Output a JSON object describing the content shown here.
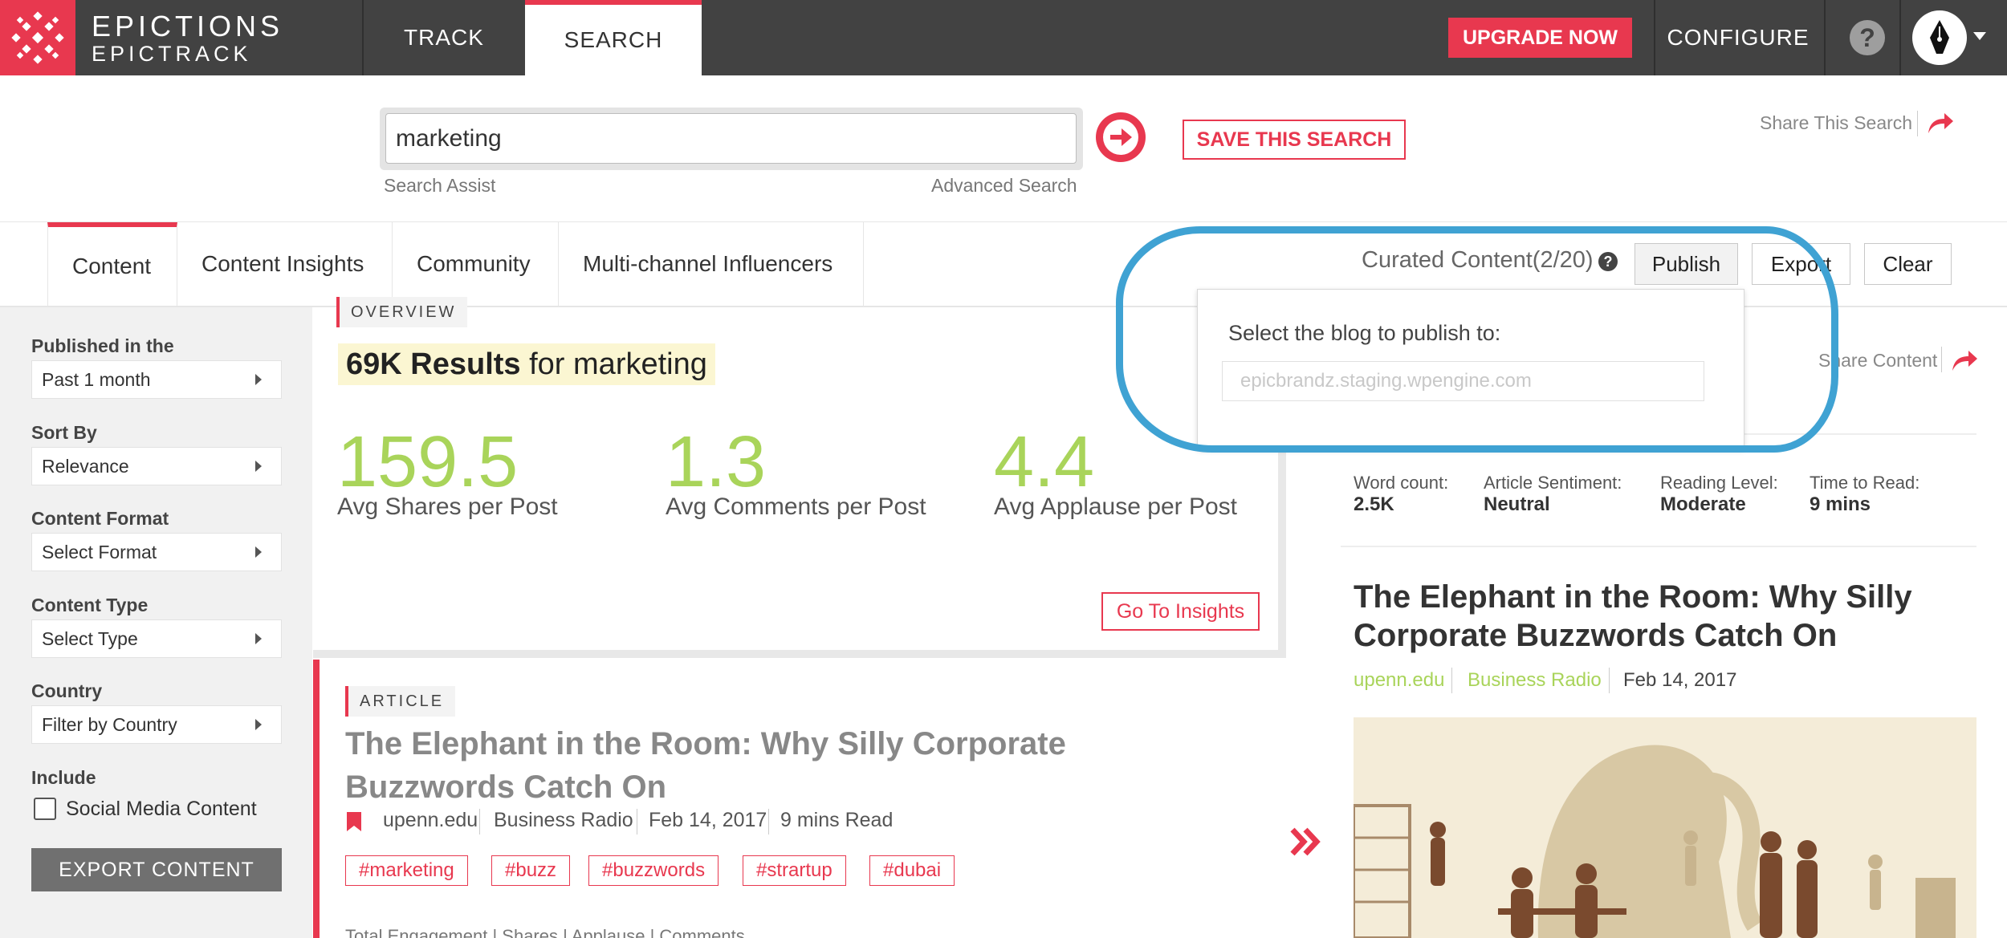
{
  "app": {
    "brand_line1": "EPICTIONS",
    "brand_line2": "EPICTRACK",
    "nav": [
      "TRACK",
      "SEARCH"
    ],
    "upgrade": "UPGRADE NOW",
    "configure": "CONFIGURE",
    "help": "?"
  },
  "search": {
    "value": "marketing",
    "assist": "Search Assist",
    "advanced": "Advanced Search",
    "save": "SAVE THIS SEARCH",
    "share": "Share This Search"
  },
  "tabs": [
    "Content",
    "Content Insights",
    "Community",
    "Multi-channel Influencers"
  ],
  "curated": {
    "label": "Curated Content(2/20)",
    "publish": "Publish",
    "export": "Export",
    "clear": "Clear"
  },
  "popup": {
    "label": "Select the blog to publish to:",
    "placeholder": "epicbrandz.staging.wpengine.com"
  },
  "sidebar": {
    "published_label": "Published in the",
    "published_value": "Past 1 month",
    "sort_label": "Sort By",
    "sort_value": "Relevance",
    "format_label": "Content Format",
    "format_value": "Select Format",
    "type_label": "Content Type",
    "type_value": "Select Type",
    "country_label": "Country",
    "country_value": "Filter by Country",
    "include_label": "Include",
    "social_label": "Social Media Content",
    "export_button": "EXPORT CONTENT"
  },
  "overview": {
    "tag": "OVERVIEW",
    "results_count": "69K Results",
    "results_for": "for",
    "results_query": "marketing",
    "stats": [
      {
        "value": "159.5",
        "caption": "Avg Shares per Post"
      },
      {
        "value": "1.3",
        "caption": "Avg Comments per Post"
      },
      {
        "value": "4.4",
        "caption": "Avg Applause per Post"
      }
    ],
    "insights_button": "Go To Insights"
  },
  "article": {
    "tag": "ARTICLE",
    "title": "The Elephant in the Room: Why Silly Corporate Buzzwords Catch On",
    "source": "upenn.edu",
    "category": "Business Radio",
    "date": "Feb 14, 2017",
    "read_time": "9 mins Read",
    "hashtags": [
      "#marketing",
      "#buzz",
      "#buzzwords",
      "#strartup",
      "#dubai"
    ],
    "stats_footer": "Total Engagement  |  Shares  |  Applause  |  Comments"
  },
  "right_panel": {
    "share": "Share Content",
    "stats": [
      {
        "label": "Word count:",
        "value": "2.5K"
      },
      {
        "label": "Article Sentiment:",
        "value": "Neutral"
      },
      {
        "label": "Reading Level:",
        "value": "Moderate"
      },
      {
        "label": "Time to Read:",
        "value": "9 mins"
      }
    ],
    "title": "The Elephant in the Room: Why Silly Corporate Buzzwords Catch On",
    "source": "upenn.edu",
    "category": "Business Radio",
    "date": "Feb 14, 2017"
  },
  "colors": {
    "accent": "#e8384f",
    "topbar": "#424242",
    "stat_green": "#a9d45a",
    "highlight_ring": "#3fa2d3"
  }
}
